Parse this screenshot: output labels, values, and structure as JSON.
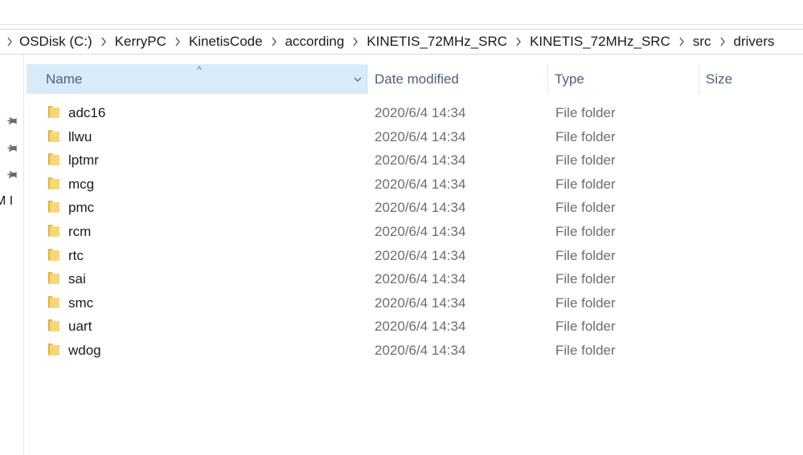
{
  "breadcrumb": {
    "items": [
      {
        "label": "OSDisk (C:)"
      },
      {
        "label": "KerryPC"
      },
      {
        "label": "KinetisCode"
      },
      {
        "label": "according"
      },
      {
        "label": "KINETIS_72MHz_SRC"
      },
      {
        "label": "KINETIS_72MHz_SRC"
      },
      {
        "label": "src"
      },
      {
        "label": "drivers"
      }
    ]
  },
  "quick_access": {
    "clipped_label": "M I"
  },
  "columns": {
    "name": "Name",
    "date_modified": "Date modified",
    "type": "Type",
    "size": "Size",
    "sort_indicator": "^"
  },
  "files": [
    {
      "name": "adc16",
      "date": "2020/6/4 14:34",
      "type": "File folder",
      "size": ""
    },
    {
      "name": "llwu",
      "date": "2020/6/4 14:34",
      "type": "File folder",
      "size": ""
    },
    {
      "name": "lptmr",
      "date": "2020/6/4 14:34",
      "type": "File folder",
      "size": ""
    },
    {
      "name": "mcg",
      "date": "2020/6/4 14:34",
      "type": "File folder",
      "size": ""
    },
    {
      "name": "pmc",
      "date": "2020/6/4 14:34",
      "type": "File folder",
      "size": ""
    },
    {
      "name": "rcm",
      "date": "2020/6/4 14:34",
      "type": "File folder",
      "size": ""
    },
    {
      "name": "rtc",
      "date": "2020/6/4 14:34",
      "type": "File folder",
      "size": ""
    },
    {
      "name": "sai",
      "date": "2020/6/4 14:34",
      "type": "File folder",
      "size": ""
    },
    {
      "name": "smc",
      "date": "2020/6/4 14:34",
      "type": "File folder",
      "size": ""
    },
    {
      "name": "uart",
      "date": "2020/6/4 14:34",
      "type": "File folder",
      "size": ""
    },
    {
      "name": "wdog",
      "date": "2020/6/4 14:34",
      "type": "File folder",
      "size": ""
    }
  ],
  "colors": {
    "header_selected_bg": "#d9ebf9",
    "header_text": "#4c607a",
    "folder_yellow": "#f8d775",
    "folder_dark": "#e8b84a"
  },
  "icons": {
    "pin": "pin-icon",
    "folder": "folder-icon",
    "chevron": "chevron-right-icon",
    "dropdown": "chevron-down-icon"
  }
}
